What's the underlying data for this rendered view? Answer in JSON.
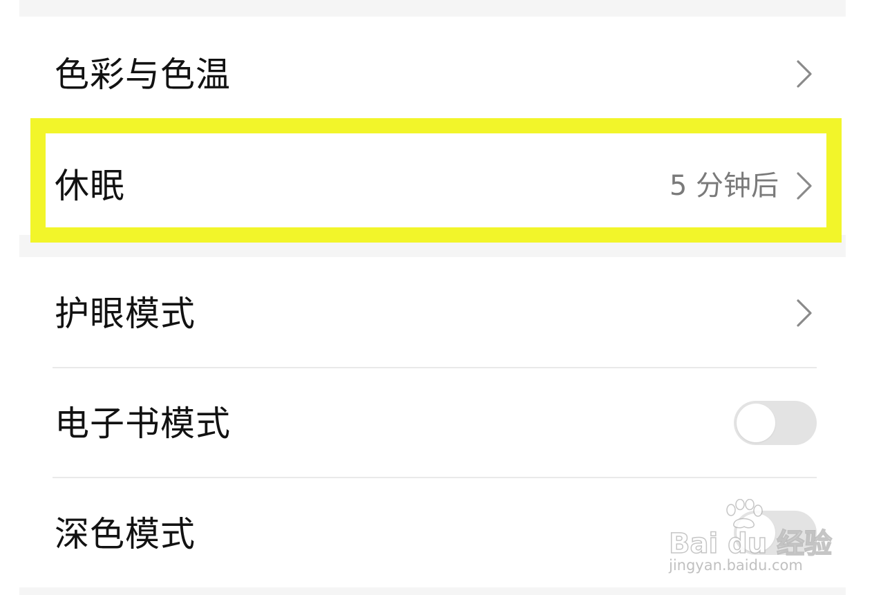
{
  "settings": {
    "color_temperature": {
      "label": "色彩与色温"
    },
    "sleep": {
      "label": "休眠",
      "value": "5 分钟后"
    },
    "eye_comfort": {
      "label": "护眼模式"
    },
    "ebook_mode": {
      "label": "电子书模式",
      "enabled": false
    },
    "dark_mode": {
      "label": "深色模式",
      "enabled": false
    }
  },
  "annotation": {
    "highlight_color": "#f2f52a",
    "highlighted_item": "sleep"
  },
  "watermark": {
    "brand": "Bai du 经验",
    "site": "jingyan.baidu.com"
  },
  "colors": {
    "background": "#ffffff",
    "section_gap": "#f5f5f5",
    "text_primary": "#121212",
    "text_secondary": "#7a7a7a",
    "toggle_off": "#e3e3e3"
  }
}
